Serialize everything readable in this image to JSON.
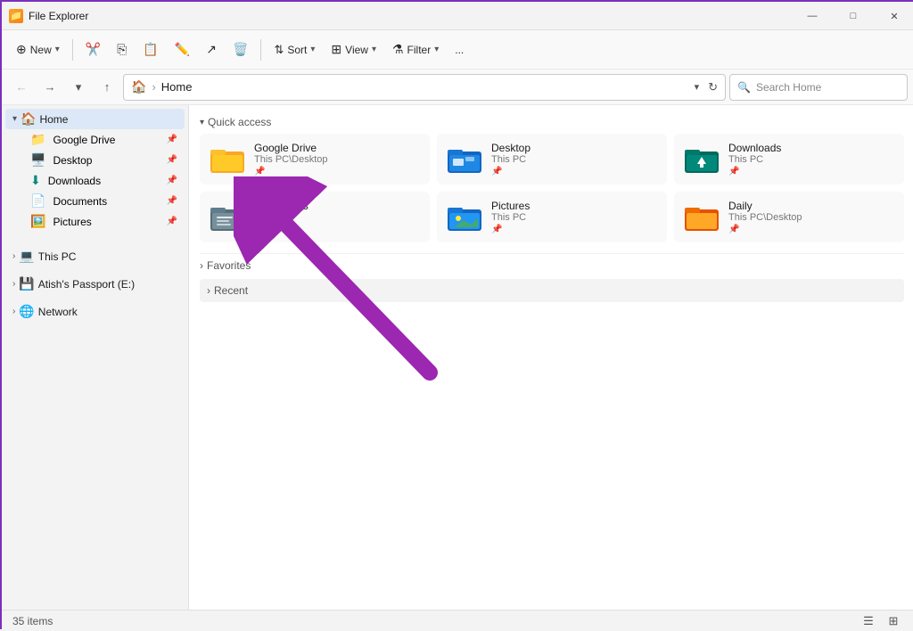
{
  "titleBar": {
    "title": "File Explorer",
    "minimize": "—",
    "maximize": "□",
    "close": "✕"
  },
  "toolbar": {
    "new_label": "New",
    "cut_label": "",
    "copy_label": "",
    "paste_label": "",
    "rename_label": "",
    "share_label": "",
    "delete_label": "",
    "sort_label": "Sort",
    "view_label": "View",
    "filter_label": "Filter",
    "more_label": "..."
  },
  "addressBar": {
    "home_icon": "🏠",
    "path": "Home",
    "search_placeholder": "Search Home"
  },
  "sidebar": {
    "home_label": "Home",
    "items": [
      {
        "label": "Google Drive",
        "icon": "📁",
        "color": "yellow",
        "pinned": true
      },
      {
        "label": "Desktop",
        "icon": "🖥️",
        "color": "blue",
        "pinned": true
      },
      {
        "label": "Downloads",
        "icon": "⬇️",
        "color": "teal",
        "pinned": true
      },
      {
        "label": "Documents",
        "icon": "📄",
        "color": "blue",
        "pinned": true
      },
      {
        "label": "Pictures",
        "icon": "🖼️",
        "color": "blue",
        "pinned": true
      }
    ],
    "this_pc_label": "This PC",
    "passport_label": "Atish's Passport (E:)",
    "network_label": "Network"
  },
  "quickAccess": {
    "section_label": "Quick access",
    "folders": [
      {
        "name": "Google Drive",
        "path": "This PC\\Desktop",
        "iconType": "yellow-folder"
      },
      {
        "name": "Desktop",
        "path": "This PC",
        "iconType": "blue-folder"
      },
      {
        "name": "Downloads",
        "path": "This PC",
        "iconType": "teal-download"
      },
      {
        "name": "Documents",
        "path": "This PC",
        "iconType": "doc-folder"
      },
      {
        "name": "Pictures",
        "path": "This PC",
        "iconType": "picture-folder"
      },
      {
        "name": "Daily",
        "path": "This PC\\Desktop",
        "iconType": "orange-folder"
      }
    ]
  },
  "favorites": {
    "label": "Favorites"
  },
  "recent": {
    "label": "Recent"
  },
  "statusBar": {
    "items_count": "35 items"
  }
}
